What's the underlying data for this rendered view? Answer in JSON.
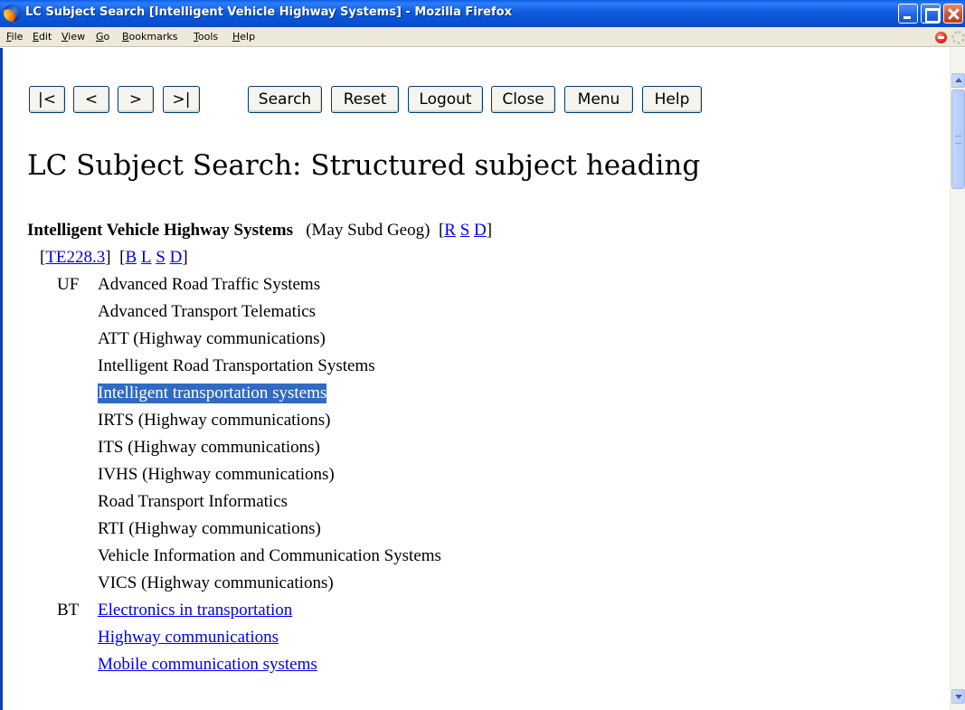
{
  "window": {
    "title": "LC Subject Search [Intelligent Vehicle Highway Systems] - Mozilla Firefox"
  },
  "menubar": {
    "items": [
      "File",
      "Edit",
      "View",
      "Go",
      "Bookmarks",
      "Tools",
      "Help"
    ]
  },
  "nav_buttons": [
    "|<",
    "<",
    ">",
    ">|",
    "Search",
    "Reset",
    "Logout",
    "Close",
    "Menu",
    "Help"
  ],
  "page": {
    "title": "LC Subject Search: Structured subject heading",
    "heading": "Intelligent Vehicle Highway Systems",
    "subd_note": "(May Subd Geog)",
    "heading_links": [
      "R",
      "S",
      "D"
    ],
    "class_number": "TE228.3",
    "class_links": [
      "B",
      "L",
      "S",
      "D"
    ],
    "uf_label": "UF",
    "uf_terms": [
      "Advanced Road Traffic Systems",
      "Advanced Transport Telematics",
      "ATT (Highway communications)",
      "Intelligent Road Transportation Systems",
      "Intelligent transportation systems",
      "IRTS (Highway communications)",
      "ITS (Highway communications)",
      "IVHS (Highway communications)",
      "Road Transport Informatics",
      "RTI (Highway communications)",
      "Vehicle Information and Communication Systems",
      "VICS (Highway communications)"
    ],
    "selected_uf_term": "Intelligent transportation systems",
    "bt_label": "BT",
    "bt_terms": [
      "Electronics in transportation",
      "Highway communications",
      "Mobile communication systems"
    ]
  },
  "colors": {
    "link": "#0000ee",
    "selection": "#316ac5",
    "titlebar": "#0751d4"
  }
}
